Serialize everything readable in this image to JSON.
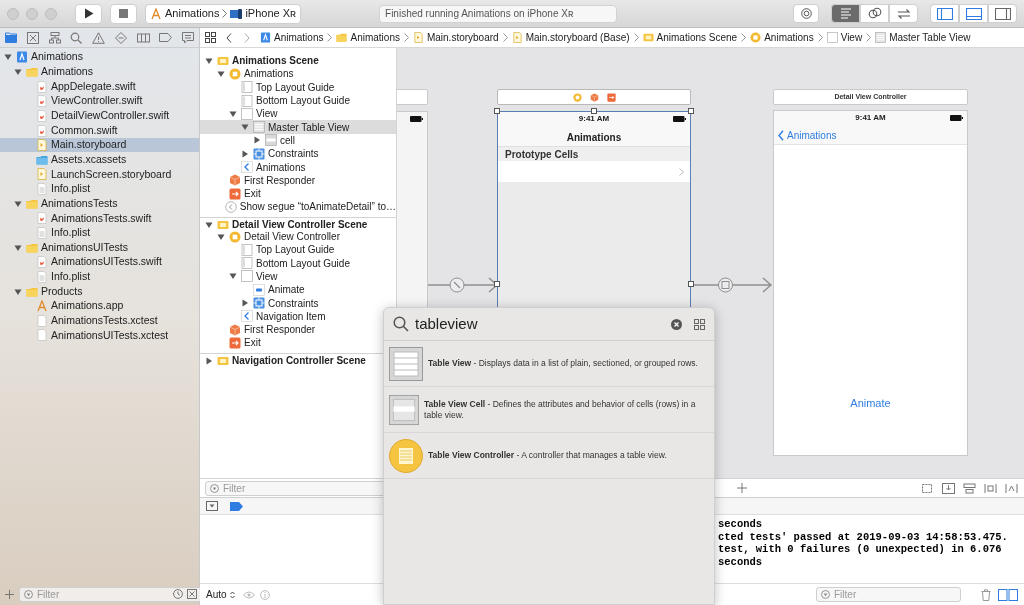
{
  "toolbar": {
    "scheme": [
      "Animations",
      "iPhone Xʀ"
    ],
    "activity": "Finished running Animations on iPhone Xʀ",
    "editor_modes": [
      {
        "selected": true
      },
      {
        "selected": false
      },
      {
        "selected": false
      }
    ],
    "panel_toggles": [
      {
        "on": true
      },
      {
        "on": true
      },
      {
        "on": false
      }
    ]
  },
  "navigator_tabs": [
    {
      "selected": true
    },
    {
      "selected": false
    },
    {
      "selected": false
    },
    {
      "selected": false
    },
    {
      "selected": false
    },
    {
      "selected": false
    },
    {
      "selected": false
    },
    {
      "selected": false
    },
    {
      "selected": false
    }
  ],
  "project_tree": [
    {
      "label": "Animations",
      "kind": "project",
      "expanded": true,
      "selected": false,
      "children": [
        {
          "label": "Animations",
          "kind": "folder",
          "expanded": true,
          "selected": false,
          "children": [
            {
              "label": "AppDelegate.swift",
              "kind": "swift",
              "selected": false
            },
            {
              "label": "ViewController.swift",
              "kind": "swift",
              "selected": false
            },
            {
              "label": "DetailViewController.swift",
              "kind": "swift",
              "selected": false
            },
            {
              "label": "Common.swift",
              "kind": "swift",
              "selected": false
            },
            {
              "label": "Main.storyboard",
              "kind": "storyboard",
              "selected": true
            },
            {
              "label": "Assets.xcassets",
              "kind": "assets",
              "selected": false
            },
            {
              "label": "LaunchScreen.storyboard",
              "kind": "storyboard",
              "selected": false
            },
            {
              "label": "Info.plist",
              "kind": "plist",
              "selected": false
            }
          ]
        },
        {
          "label": "AnimationsTests",
          "kind": "folder",
          "expanded": true,
          "selected": false,
          "children": [
            {
              "label": "AnimationsTests.swift",
              "kind": "swift",
              "selected": false
            },
            {
              "label": "Info.plist",
              "kind": "plist",
              "selected": false
            }
          ]
        },
        {
          "label": "AnimationsUITests",
          "kind": "folder",
          "expanded": true,
          "selected": false,
          "children": [
            {
              "label": "AnimationsUITests.swift",
              "kind": "swift",
              "selected": false
            },
            {
              "label": "Info.plist",
              "kind": "plist",
              "selected": false
            }
          ]
        },
        {
          "label": "Products",
          "kind": "folder",
          "expanded": true,
          "selected": false,
          "children": [
            {
              "label": "Animations.app",
              "kind": "app",
              "selected": false
            },
            {
              "label": "AnimationsTests.xctest",
              "kind": "xctest",
              "selected": false
            },
            {
              "label": "AnimationsUITests.xctest",
              "kind": "xctest",
              "selected": false
            }
          ]
        }
      ]
    }
  ],
  "navigator_filter": {
    "placeholder": "Filter"
  },
  "jump_bar": [
    {
      "label": "Animations",
      "kind": "project"
    },
    {
      "label": "Animations",
      "kind": "folder"
    },
    {
      "label": "Main.storyboard",
      "kind": "storyboard"
    },
    {
      "label": "Main.storyboard (Base)",
      "kind": "storyboard"
    },
    {
      "label": "Animations Scene",
      "kind": "scene"
    },
    {
      "label": "Animations",
      "kind": "controller"
    },
    {
      "label": "View",
      "kind": "view"
    },
    {
      "label": "Master Table View",
      "kind": "table"
    }
  ],
  "outline": [
    {
      "label": "Animations Scene",
      "kind": "scene",
      "expanded": true,
      "selected": false,
      "children": [
        {
          "label": "Animations",
          "kind": "controller",
          "expanded": true,
          "selected": false,
          "children": [
            {
              "label": "Top Layout Guide",
              "kind": "guide",
              "selected": false
            },
            {
              "label": "Bottom Layout Guide",
              "kind": "guide",
              "selected": false
            },
            {
              "label": "View",
              "kind": "view",
              "expanded": true,
              "selected": false,
              "children": [
                {
                  "label": "Master Table View",
                  "kind": "table",
                  "expanded": true,
                  "selected": true,
                  "children": [
                    {
                      "label": "cell",
                      "kind": "cell",
                      "expanded": false,
                      "selected": false
                    }
                  ]
                },
                {
                  "label": "Constraints",
                  "kind": "constraints",
                  "expanded": false,
                  "selected": false
                }
              ]
            },
            {
              "label": "Animations",
              "kind": "nav-item",
              "selected": false
            }
          ]
        },
        {
          "label": "First Responder",
          "kind": "responder",
          "selected": false
        },
        {
          "label": "Exit",
          "kind": "exit",
          "selected": false
        },
        {
          "label": "Show segue “toAnimateDetail” to…",
          "kind": "segue",
          "selected": false
        }
      ]
    },
    {
      "label": "Detail View Controller Scene",
      "kind": "scene",
      "expanded": true,
      "selected": false,
      "children": [
        {
          "label": "Detail View Controller",
          "kind": "controller",
          "expanded": true,
          "selected": false,
          "children": [
            {
              "label": "Top Layout Guide",
              "kind": "guide",
              "selected": false
            },
            {
              "label": "Bottom Layout Guide",
              "kind": "guide",
              "selected": false
            },
            {
              "label": "View",
              "kind": "view",
              "expanded": true,
              "selected": false,
              "children": [
                {
                  "label": "Animate",
                  "kind": "button",
                  "selected": false
                },
                {
                  "label": "Constraints",
                  "kind": "constraints",
                  "expanded": false,
                  "selected": false
                }
              ]
            },
            {
              "label": "Navigation Item",
              "kind": "nav-item",
              "selected": false
            }
          ]
        },
        {
          "label": "First Responder",
          "kind": "responder",
          "selected": false
        },
        {
          "label": "Exit",
          "kind": "exit",
          "selected": false
        }
      ]
    },
    {
      "label": "Navigation Controller Scene",
      "kind": "scene",
      "expanded": false,
      "selected": false
    }
  ],
  "outline_filter": {
    "placeholder": "Filter"
  },
  "master_scene": {
    "selected": true,
    "status_time": "9:41 AM",
    "nav_title": "Animations",
    "section": "Prototype Cells"
  },
  "detail_scene": {
    "title": "Detail View Controller",
    "status_time": "9:41 AM",
    "back": "Animations",
    "button": "Animate"
  },
  "library": {
    "query": "tableview",
    "items": [
      {
        "kind": "table",
        "text": "**Table View** - Displays data in a list of plain, sectioned, or grouped rows."
      },
      {
        "kind": "cell",
        "text": "**Table View Cell** - Defines the attributes and behavior of cells (rows) in a table view."
      },
      {
        "kind": "controller",
        "text": "**Table View Controller** - A controller that manages a table view."
      }
    ]
  },
  "debug": {
    "breakpoints_active": true,
    "scope": "Auto",
    "console_lines": [
      "seconds",
      "cted tests' passed at 2019-09-03 14:58:53.475.",
      "test, with 0 failures (0 unexpected) in 6.076",
      "seconds"
    ],
    "console_filter": {
      "placeholder": "Filter"
    }
  }
}
